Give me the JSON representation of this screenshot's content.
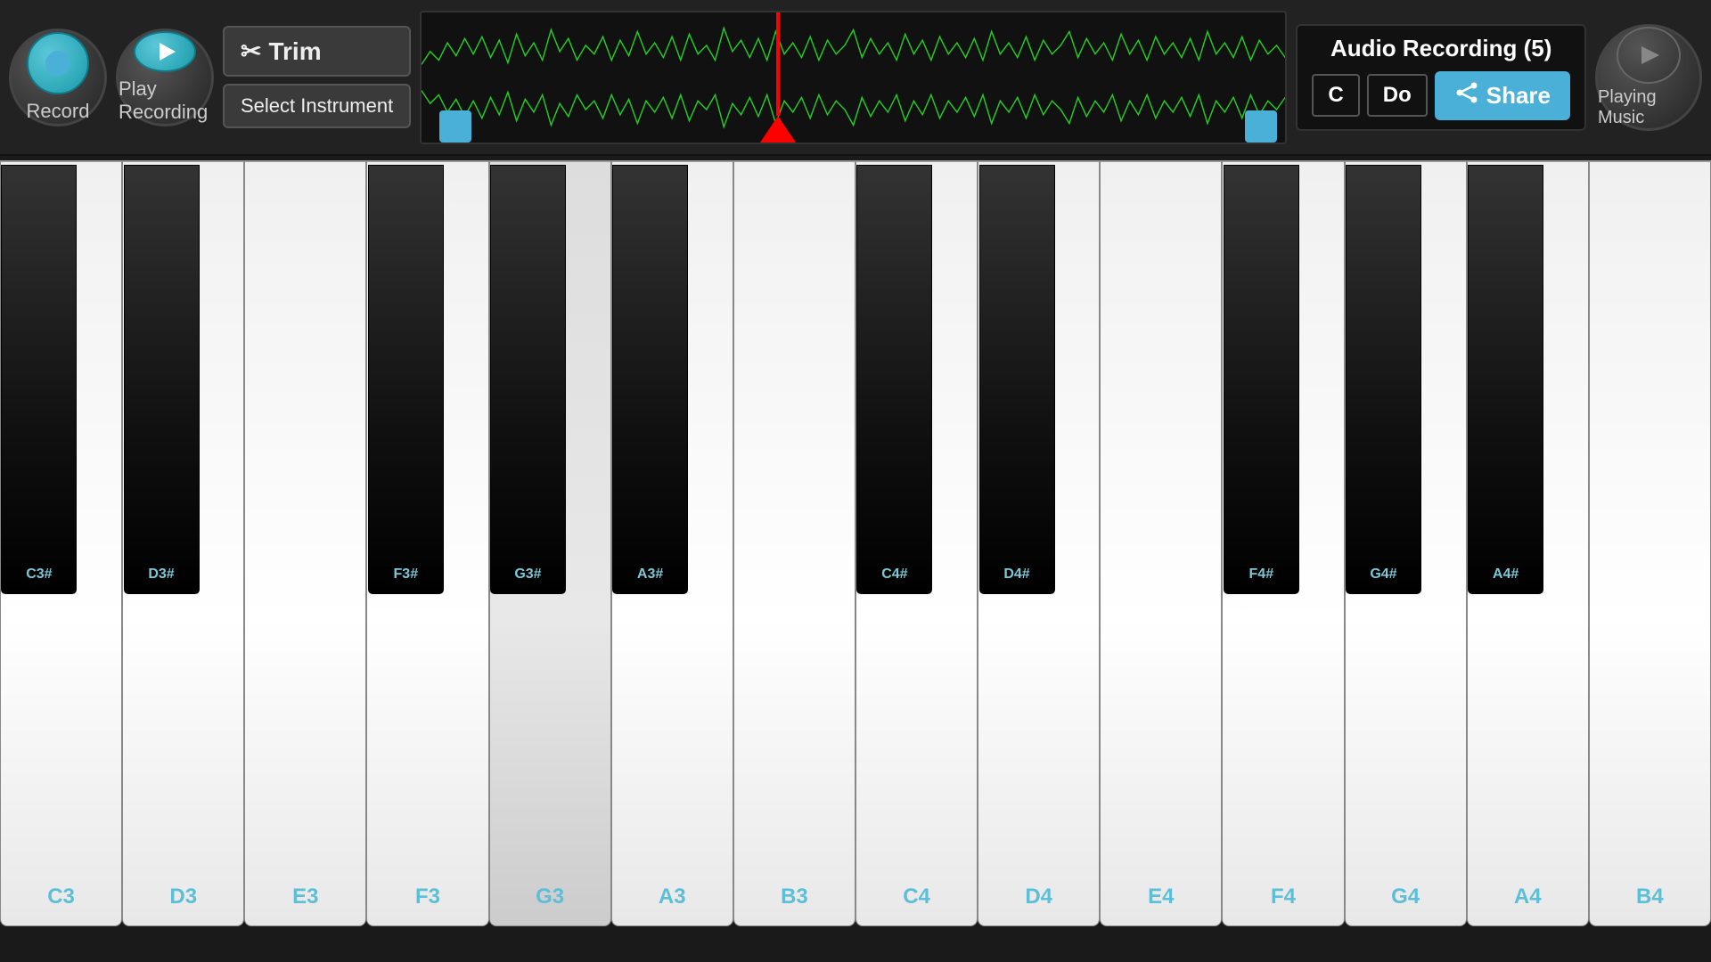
{
  "topbar": {
    "record_label": "Record",
    "play_recording_label": "Play Recording",
    "trim_label": "Trim",
    "select_instrument_label": "Select Instrument",
    "audio_recording_title": "Audio Recording (5)",
    "key_label": "C",
    "solfege_label": "Do",
    "share_label": "Share",
    "playing_music_label": "Playing Music"
  },
  "piano": {
    "white_keys": [
      {
        "label": "C3",
        "id": "C3"
      },
      {
        "label": "D3",
        "id": "D3"
      },
      {
        "label": "E3",
        "id": "E3"
      },
      {
        "label": "F3",
        "id": "F3"
      },
      {
        "label": "G3",
        "id": "G3",
        "active": true
      },
      {
        "label": "A3",
        "id": "A3"
      },
      {
        "label": "B3",
        "id": "B3"
      },
      {
        "label": "C4",
        "id": "C4"
      },
      {
        "label": "D4",
        "id": "D4"
      },
      {
        "label": "E4",
        "id": "E4"
      },
      {
        "label": "F4",
        "id": "F4"
      },
      {
        "label": "G4",
        "id": "G4"
      },
      {
        "label": "A4",
        "id": "A4"
      },
      {
        "label": "B4",
        "id": "B4"
      }
    ],
    "black_keys": [
      {
        "label": "C3#",
        "id": "C3s",
        "position": 1
      },
      {
        "label": "D3#",
        "id": "D3s",
        "position": 2
      },
      {
        "label": "F3#",
        "id": "F3s",
        "position": 4
      },
      {
        "label": "G3#",
        "id": "G3s",
        "position": 5
      },
      {
        "label": "A3#",
        "id": "A3s",
        "position": 6
      },
      {
        "label": "C4#",
        "id": "C4s",
        "position": 8
      },
      {
        "label": "D4#",
        "id": "D4s",
        "position": 9
      },
      {
        "label": "F4#",
        "id": "F4s",
        "position": 11
      },
      {
        "label": "G4#",
        "id": "G4s",
        "position": 12
      },
      {
        "label": "A4#",
        "id": "A4s",
        "position": 13
      }
    ]
  }
}
